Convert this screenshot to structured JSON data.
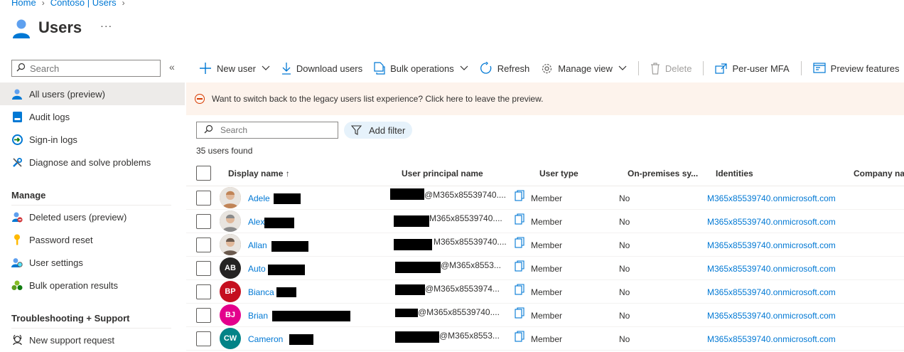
{
  "breadcrumb": {
    "items": [
      "Home",
      "Contoso | Users"
    ]
  },
  "page": {
    "title": "Users",
    "more": "···"
  },
  "sidebar": {
    "search_placeholder": "Search",
    "collapse": "«",
    "items": [
      {
        "label": "All users (preview)",
        "icon": "user-icon",
        "active": true
      },
      {
        "label": "Audit logs",
        "icon": "audit-log-icon"
      },
      {
        "label": "Sign-in logs",
        "icon": "sign-in-icon"
      },
      {
        "label": "Diagnose and solve problems",
        "icon": "wrench-icon"
      }
    ],
    "sections": [
      {
        "heading": "Manage",
        "items": [
          {
            "label": "Deleted users (preview)",
            "icon": "deleted-user-icon"
          },
          {
            "label": "Password reset",
            "icon": "key-icon"
          },
          {
            "label": "User settings",
            "icon": "user-settings-icon"
          },
          {
            "label": "Bulk operation results",
            "icon": "bulk-results-icon"
          }
        ]
      },
      {
        "heading": "Troubleshooting + Support",
        "items": [
          {
            "label": "New support request",
            "icon": "support-icon"
          }
        ]
      }
    ]
  },
  "toolbar": {
    "new_user": "New user",
    "download_users": "Download users",
    "bulk_operations": "Bulk operations",
    "refresh": "Refresh",
    "manage_view": "Manage view",
    "delete": "Delete",
    "per_user_mfa": "Per-user MFA",
    "preview_features": "Preview features"
  },
  "banner": {
    "text": "Want to switch back to the legacy users list experience? Click here to leave the preview."
  },
  "filters": {
    "search_placeholder": "Search",
    "add_filter": "Add filter"
  },
  "results": {
    "count_text": "35 users found"
  },
  "table": {
    "headers": {
      "display_name": "Display name ↑",
      "upn": "User principal name",
      "user_type": "User type",
      "on_premises": "On-premises sy...",
      "identities": "Identities",
      "company": "Company na"
    },
    "rows": [
      {
        "name": "Adele",
        "upn": "@M365x85539740....",
        "type": "Member",
        "onprem": "No",
        "identity": "M365x85539740.onmicrosoft.com",
        "avatar": "photo",
        "color": "#c08457"
      },
      {
        "name": "Alex",
        "upn": "M365x85539740....",
        "type": "Member",
        "onprem": "No",
        "identity": "M365x85539740.onmicrosoft.com",
        "avatar": "photo",
        "color": "#8a8a8a"
      },
      {
        "name": "Allan",
        "upn": "M365x85539740....",
        "type": "Member",
        "onprem": "No",
        "identity": "M365x85539740.onmicrosoft.com",
        "avatar": "photo",
        "color": "#6b5a4e"
      },
      {
        "name": "Auto",
        "upn": "@M365x8553...",
        "type": "Member",
        "onprem": "No",
        "identity": "M365x85539740.onmicrosoft.com",
        "avatar": "AB",
        "color": "#252423"
      },
      {
        "name": "Bianca",
        "upn": "@M365x8553974...",
        "type": "Member",
        "onprem": "No",
        "identity": "M365x85539740.onmicrosoft.com",
        "avatar": "BP",
        "color": "#c50f1f"
      },
      {
        "name": "Brian",
        "upn": "@M365x85539740....",
        "type": "Member",
        "onprem": "No",
        "identity": "M365x85539740.onmicrosoft.com",
        "avatar": "BJ",
        "color": "#e3008c"
      },
      {
        "name": "Cameron",
        "upn": "@M365x8553...",
        "type": "Member",
        "onprem": "No",
        "identity": "M365x85539740.onmicrosoft.com",
        "avatar": "CW",
        "color": "#038387"
      }
    ]
  }
}
